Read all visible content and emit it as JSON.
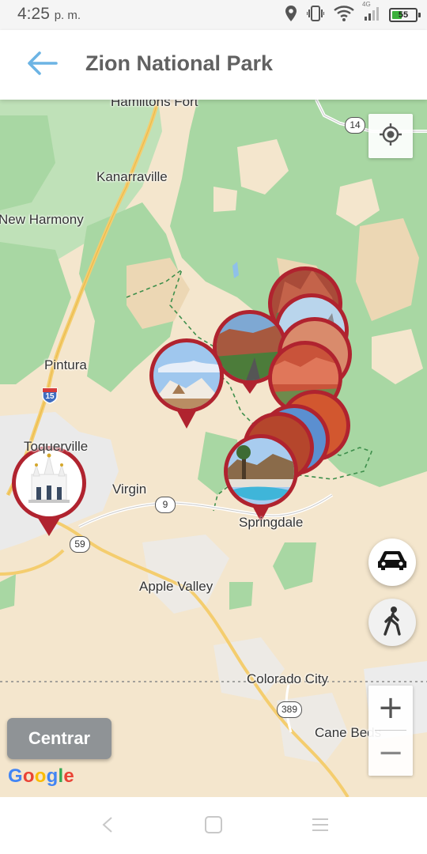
{
  "status_bar": {
    "time": "4:25",
    "ampm": "p. m.",
    "network_type": "4G",
    "battery_level": "55"
  },
  "app_bar": {
    "title": "Zion National Park",
    "back_icon": "arrow-left-icon"
  },
  "map": {
    "park_label": "Zion National Park",
    "towns": {
      "hamiltons_fort": "Hamiltons Fort",
      "kanarraville": "Kanarraville",
      "new_harmony": "New Harmony",
      "pintura": "Pintura",
      "toquerville": "Toquerville",
      "virgin": "Virgin",
      "springdale": "Springdale",
      "apple_valley": "Apple Valley",
      "colorado_city": "Colorado City",
      "cane_beds": "Cane Beds"
    },
    "routes": {
      "r14": "14",
      "r15": "15",
      "r9": "9",
      "r59": "59",
      "r389": "389"
    },
    "pin_images": [
      "red-rock-canyon",
      "narrow-canyon-trail",
      "scenic-road-canyon",
      "tent-glamping",
      "red-cliffs",
      "resort-pool",
      "temple"
    ]
  },
  "controls": {
    "center_button": "Centrar",
    "location_icon": "my-location-icon",
    "driving_icon": "car-icon",
    "walking_icon": "walking-person-icon",
    "zoom_in": "+",
    "zoom_out": "−",
    "attribution": {
      "g1": "G",
      "o1": "o",
      "o2": "o",
      "g2": "g",
      "l": "l",
      "e": "e"
    }
  },
  "nav_bar": {
    "icons": [
      "back-triangle-icon",
      "home-square-icon",
      "menu-lines-icon"
    ]
  },
  "colors": {
    "accent": "#6cb4e4",
    "pin_border": "#b0232f",
    "map_land": "#f4e6cd",
    "map_forest": "#a8d7a3",
    "road": "#f4cd6e"
  }
}
